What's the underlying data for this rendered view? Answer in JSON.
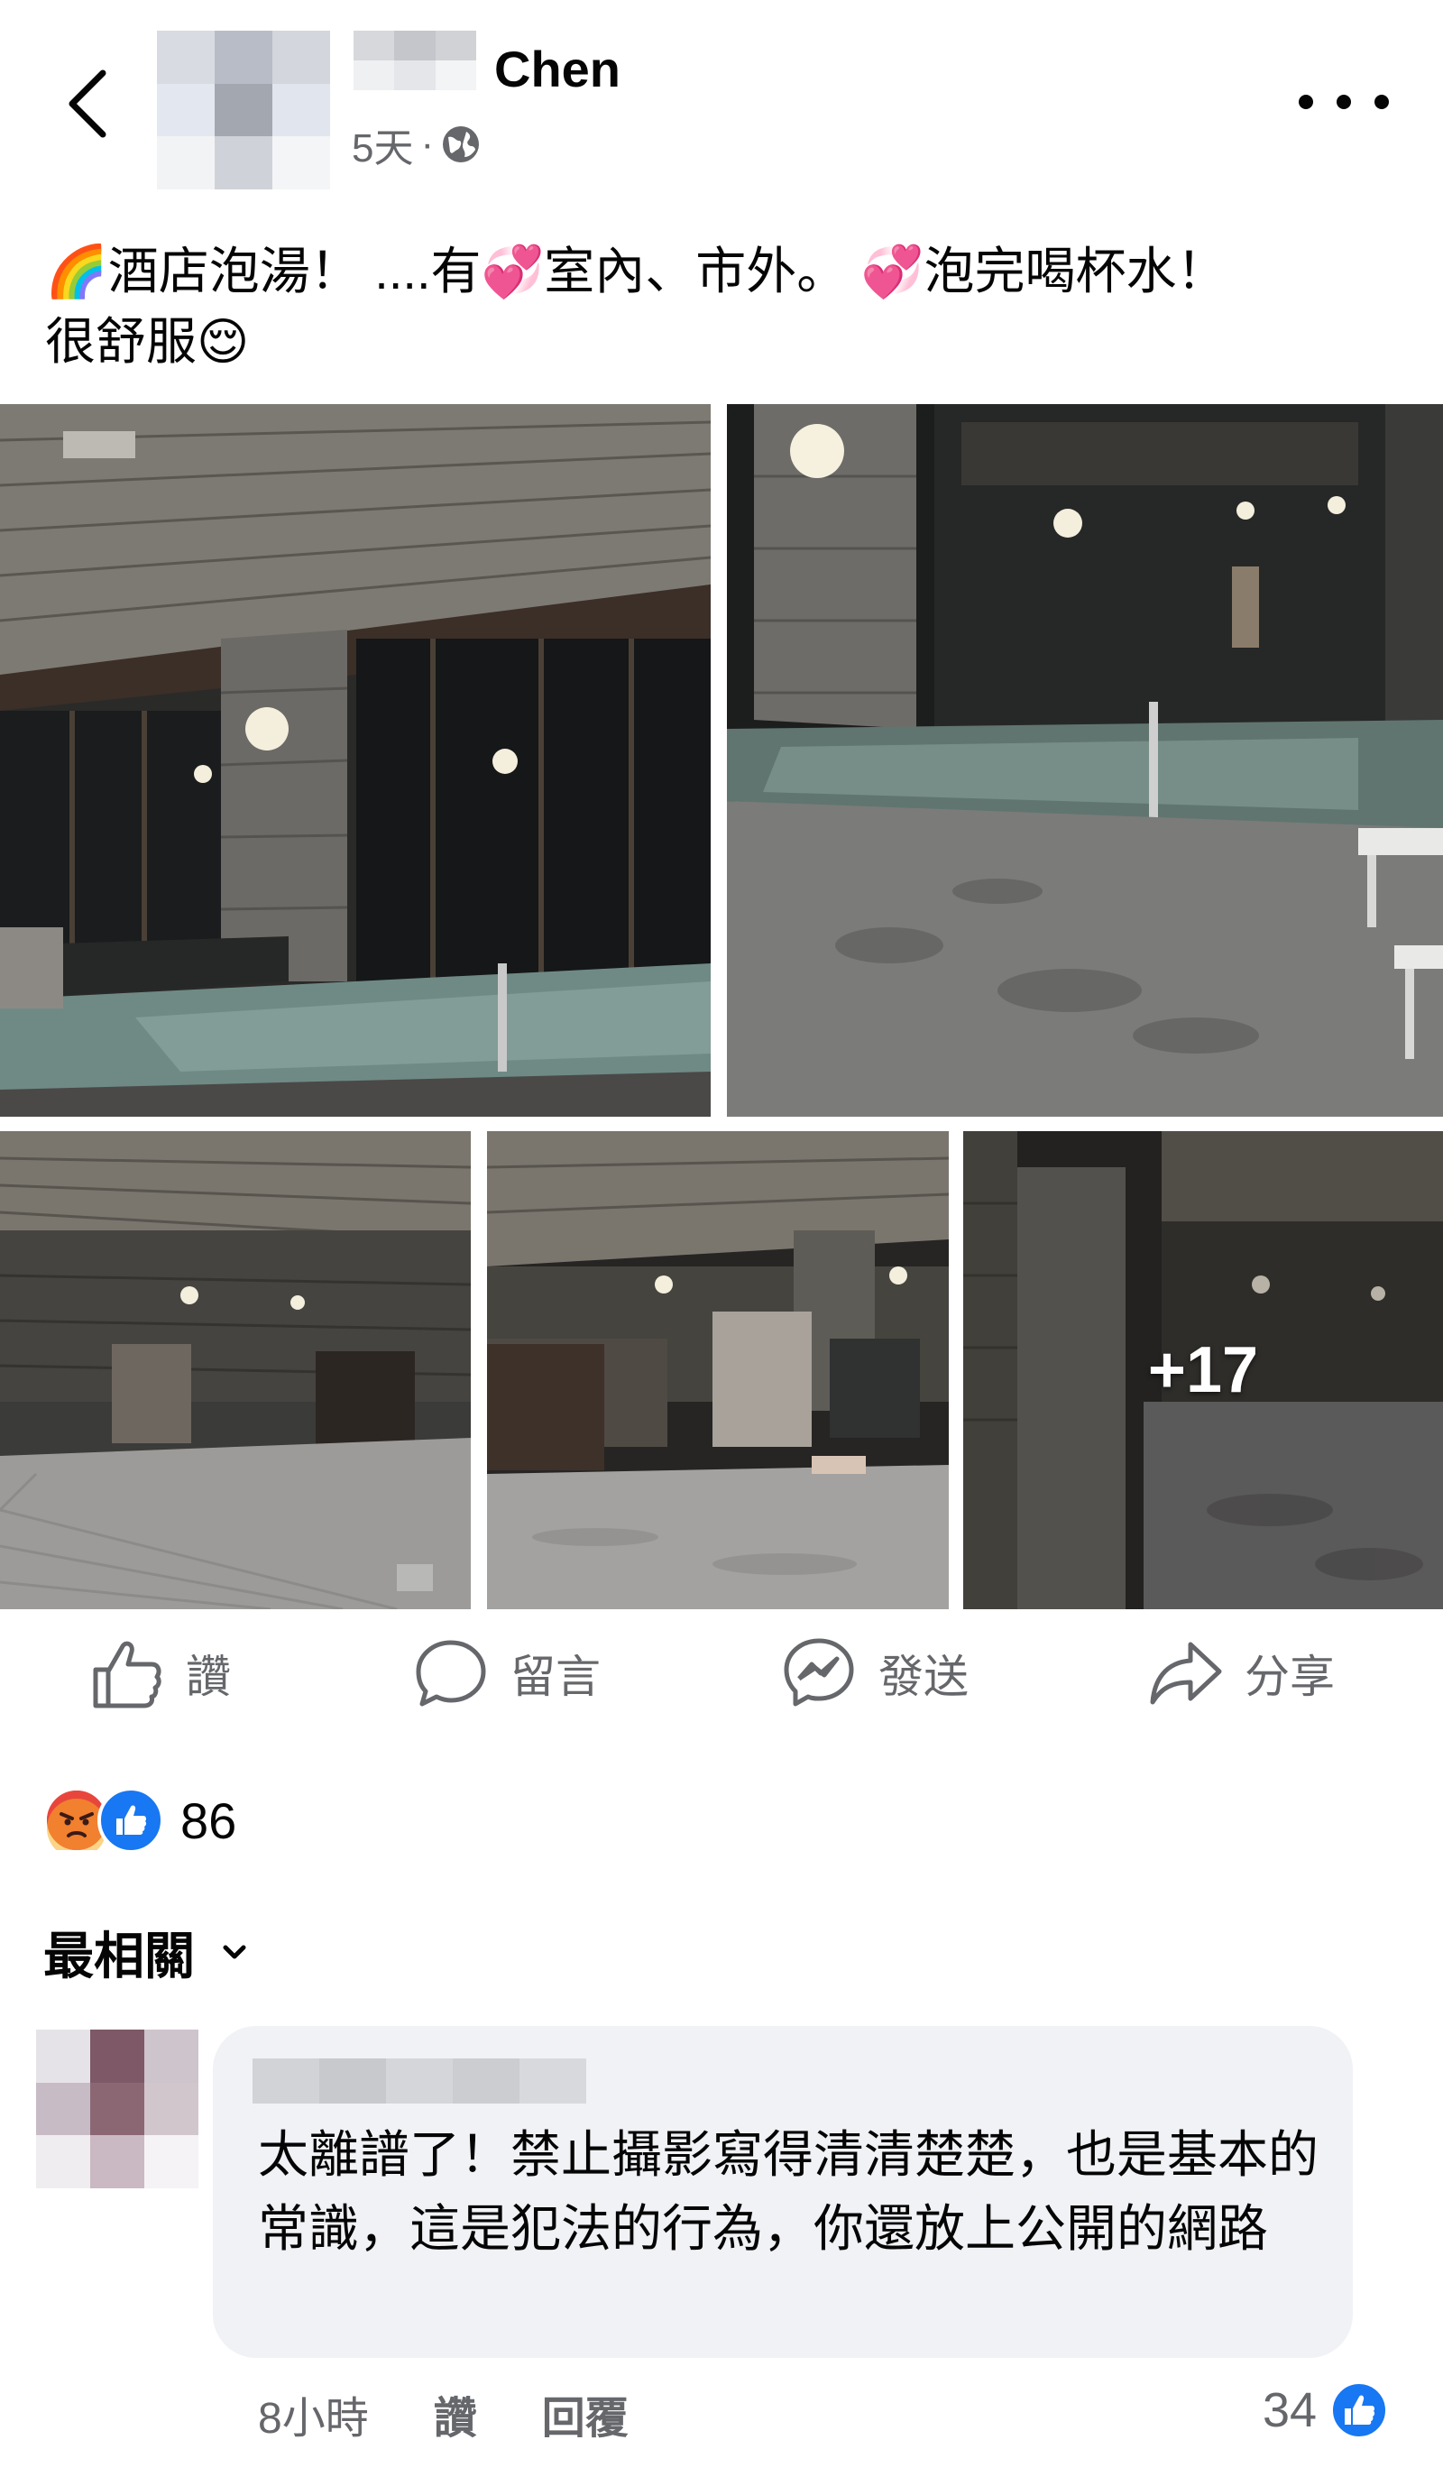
{
  "header": {
    "author_name": "Chen",
    "timestamp": "5天",
    "separator": "·",
    "privacy_icon": "globe-icon",
    "back_icon": "chevron-left-icon",
    "more_icon": "more-horizontal-icon"
  },
  "post": {
    "text": "🌈酒店泡湯！ ....有💞室內、市外。 💞泡完喝杯水！\n很舒服😌",
    "more_photos_label": "+17"
  },
  "actions": {
    "like_label": "讚",
    "comment_label": "留言",
    "send_label": "發送",
    "share_label": "分享"
  },
  "reactions": {
    "count": "86",
    "types": [
      "angry",
      "like"
    ],
    "angry_color": "#e8463d",
    "like_color": "#1877f2"
  },
  "comments_sort": {
    "label": "最相關",
    "icon": "chevron-down-icon"
  },
  "comment": {
    "text": "太離譜了！禁止攝影寫得清清楚楚，也是基本的常識，這是犯法的行為，你還放上公開的網路",
    "time": "8小時",
    "like_label": "讚",
    "reply_label": "回覆",
    "like_count": "34"
  },
  "colors": {
    "secondary_text": "#65676b",
    "bubble_bg": "#f0f2f5",
    "brand_blue": "#1877f2"
  }
}
